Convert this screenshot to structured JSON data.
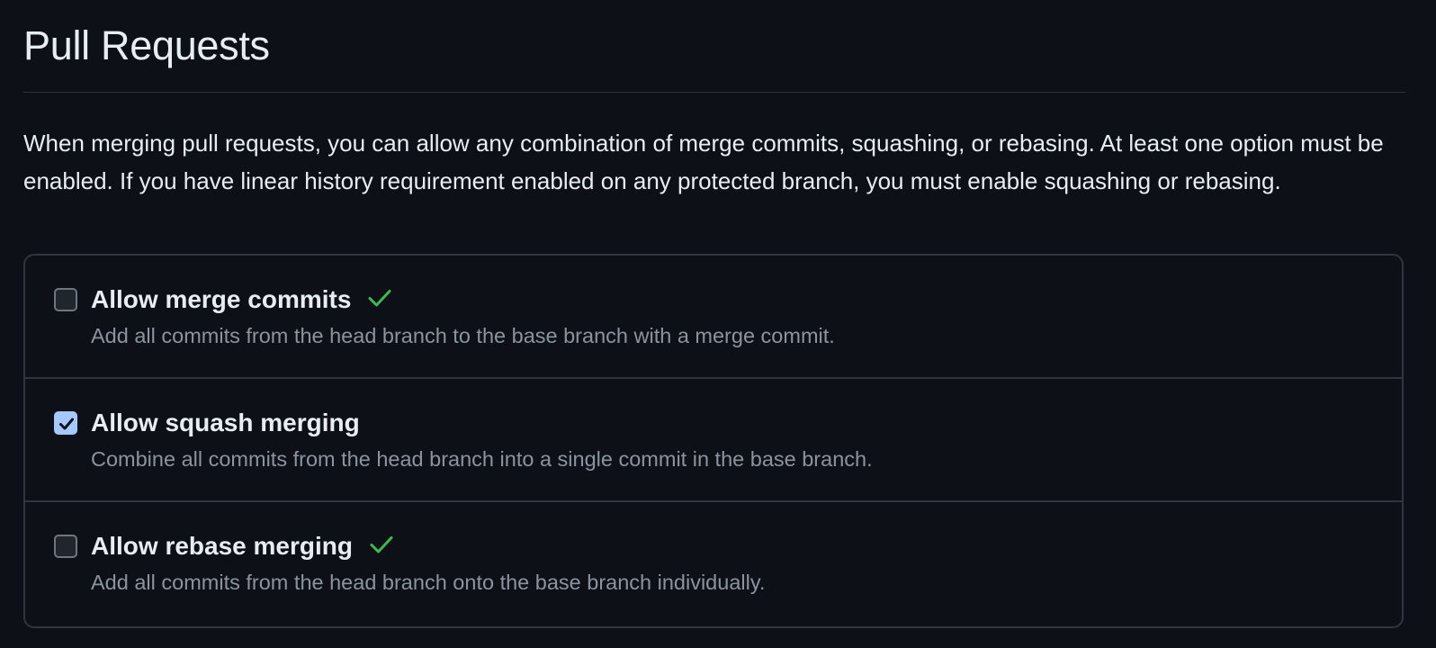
{
  "section": {
    "title": "Pull Requests",
    "intro": "When merging pull requests, you can allow any combination of merge commits, squashing, or rebasing. At least one option must be enabled. If you have linear history requirement enabled on any protected branch, you must enable squashing or rebasing."
  },
  "options": [
    {
      "label": "Allow merge commits",
      "description": "Add all commits from the head branch to the base branch with a merge commit.",
      "checked": false,
      "status_icon": "check-icon"
    },
    {
      "label": "Allow squash merging",
      "description": "Combine all commits from the head branch into a single commit in the base branch.",
      "checked": true,
      "status_icon": null
    },
    {
      "label": "Allow rebase merging",
      "description": "Add all commits from the head branch onto the base branch individually.",
      "checked": false,
      "status_icon": "check-icon"
    }
  ],
  "colors": {
    "background": "#0d1117",
    "border": "#30363d",
    "text_primary": "#e6edf3",
    "text_muted": "#8b949e",
    "checkbox_checked": "#a5c8ff",
    "success_check": "#3fb950"
  }
}
